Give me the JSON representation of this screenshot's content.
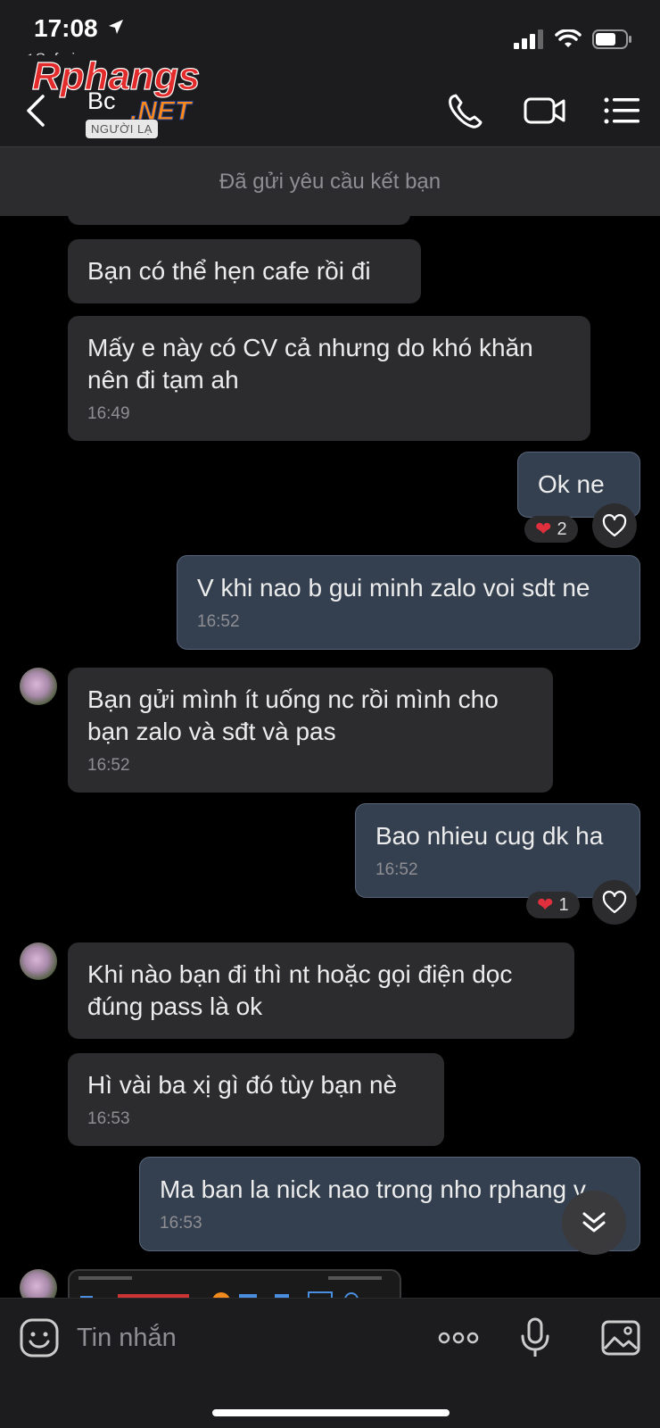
{
  "status_bar": {
    "time": "17:08",
    "back_app": "Safari"
  },
  "header": {
    "contact_name": "Bc",
    "badge": "NGƯỜI LẠ",
    "watermark_primary": "Rphangs",
    "watermark_secondary": ".NET"
  },
  "banner": {
    "text": "Đã gửi yêu cầu kết bạn"
  },
  "messages": [
    {
      "dir": "in",
      "text": "Bạn có thể hẹn cafe rồi đi",
      "time": ""
    },
    {
      "dir": "in",
      "text": "Mấy e này có CV cả nhưng do khó khăn nên đi tạm ah",
      "time": "16:49"
    },
    {
      "dir": "out",
      "text": "Ok ne",
      "time": "",
      "reaction_count": "2"
    },
    {
      "dir": "out",
      "text": "V khi nao b gui minh zalo voi sdt ne",
      "time": "16:52"
    },
    {
      "dir": "in",
      "text": "Bạn gửi mình ít uống nc rồi mình cho bạn zalo và sđt và pas",
      "time": "16:52"
    },
    {
      "dir": "out",
      "text": "Bao nhieu cug dk ha",
      "time": "16:52",
      "reaction_count": "1"
    },
    {
      "dir": "in",
      "text": "Khi nào bạn đi thì nt hoặc gọi điện dọc đúng pass là ok",
      "time": ""
    },
    {
      "dir": "in",
      "text": "Hì vài ba xị gì đó tùy bạn nè",
      "time": "16:53"
    },
    {
      "dir": "out",
      "text": "Ma ban la nick nao trong nho rphang v",
      "time": "16:53"
    }
  ],
  "input": {
    "placeholder": "Tin nhắn"
  },
  "colors": {
    "incoming_bubble": "#2c2c2e",
    "outgoing_bubble": "#34404f",
    "heart": "#e0303e",
    "background": "#000000"
  }
}
